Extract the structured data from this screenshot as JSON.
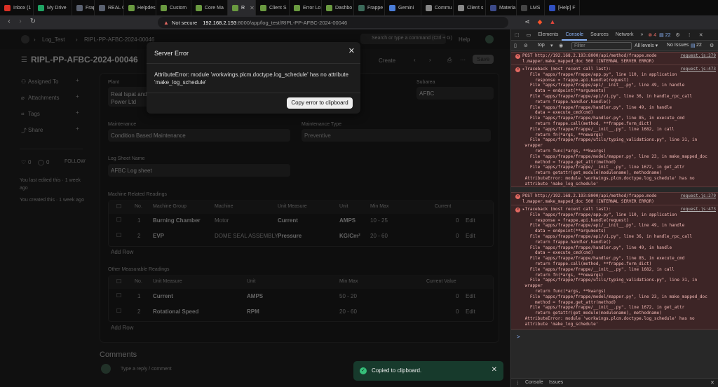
{
  "browser": {
    "tabs": [
      {
        "label": "Inbox (1",
        "color": "#d93025"
      },
      {
        "label": "My Drive",
        "color": "#1fa463"
      },
      {
        "label": "Frappe",
        "color": "#5a6170"
      },
      {
        "label": "REAL Gr",
        "color": "#5a6170"
      },
      {
        "label": "Helpdes",
        "color": "#6a9a40"
      },
      {
        "label": "Custom",
        "color": "#6a9a40"
      },
      {
        "label": "Core Ma",
        "color": "#6a9a40"
      },
      {
        "label": "R",
        "color": "#6a9a40"
      },
      {
        "label": "Client S",
        "color": "#6a9a40"
      },
      {
        "label": "Error Lo",
        "color": "#6a9a40"
      },
      {
        "label": "Dashbo",
        "color": "#6a9a40"
      },
      {
        "label": "Frappe",
        "color": "#3c6a5a"
      },
      {
        "label": "Gemini",
        "color": "#4a7dd9"
      },
      {
        "label": "Commu",
        "color": "#888888"
      },
      {
        "label": "Client s",
        "color": "#888888"
      },
      {
        "label": "Materia",
        "color": "#3c4a8a"
      },
      {
        "label": "LMS",
        "color": "#444444"
      },
      {
        "label": "[Help] F",
        "color": "#3050c0"
      }
    ],
    "security_label": "Not secure",
    "url_host": "192.168.2.193",
    "url_path": ":8000/app/log_test/RIPL-PP-AFBC-2024-00046"
  },
  "app": {
    "breadcrumb": "Log_Test",
    "breadcrumb_doc": "RIPL-PP-AFBC-2024-00046",
    "search_placeholder": "Search or type a command (Ctrl + G)",
    "help_label": "Help",
    "title": "RIPL-PP-AFBC-2024-00046",
    "create_label": "Create",
    "save_label": "Save",
    "sidebar": {
      "assigned_to": "Assigned To",
      "attachments": "Attachments",
      "tags": "Tags",
      "share": "Share",
      "likes": "0",
      "comments_count": "0",
      "follow": "FOLLOW",
      "last_edited": "You last edited this · 1 week ago",
      "created": "You created this · 1 week ago"
    },
    "fields": {
      "plant_label": "Plant",
      "plant_value": "Real Ispat and Power Ltd",
      "subarea_label": "Subarea",
      "subarea_value": "AFBC",
      "maintenance_label": "Maintenance",
      "maintenance_value": "Condition Based Maintenance",
      "maintenance_type_label": "Maintenance Type",
      "maintenance_type_value": "Preventive",
      "log_sheet_label": "Log Sheet Name",
      "log_sheet_value": "AFBC Log sheet"
    },
    "machine_readings": {
      "section_label": "Machine Related Readings",
      "headers": [
        "No.",
        "Machine Group",
        "Machine",
        "Unit Measure",
        "Unit",
        "Min Max",
        "Current"
      ],
      "rows": [
        {
          "no": "1",
          "group": "Burning Chamber",
          "machine": "Motor",
          "measure": "Current",
          "unit": "AMPS",
          "minmax": "10 - 25",
          "current": "0",
          "edit": "Edit"
        },
        {
          "no": "2",
          "group": "EVP",
          "machine": "DOME SEAL ASSEMBLY",
          "measure": "Pressure",
          "unit": "KG/Cm²",
          "minmax": "20 - 60",
          "current": "0",
          "edit": "Edit"
        }
      ],
      "add_row": "Add Row"
    },
    "other_readings": {
      "section_label": "Other Measurable Readings",
      "headers": [
        "No.",
        "Unit Measure",
        "Unit",
        "Min Max",
        "Current Value"
      ],
      "rows": [
        {
          "no": "1",
          "measure": "Current",
          "unit": "AMPS",
          "minmax": "50 - 20",
          "current": "0",
          "edit": "Edit"
        },
        {
          "no": "2",
          "measure": "Rotational Speed",
          "unit": "RPM",
          "minmax": "20 - 60",
          "current": "0",
          "edit": "Edit"
        }
      ],
      "add_row": "Add Row"
    },
    "comments_heading": "Comments",
    "comment_placeholder": "Type a reply / comment"
  },
  "modal": {
    "title": "Server Error",
    "message": "AttributeError: module 'workwings.plcm.doctype.log_schedule' has no attribute 'make_log_schedule'",
    "copy_button": "Copy error to clipboard"
  },
  "toast": {
    "message": "Copied to clipboard."
  },
  "devtools": {
    "tabs": [
      "Elements",
      "Console",
      "Sources",
      "Network"
    ],
    "error_count": "4",
    "message_count": "22",
    "context": "top",
    "filter_placeholder": "Filter",
    "levels": "All levels ▾",
    "issues_label": "No Issues",
    "issues_count": "22",
    "errors": [
      {
        "post_line_1": "POST http://192.168.2.193:8000/api/method/frappe.mode",
        "post_line_2": "l.mapper.make_mapped_doc 500 (INTERNAL SERVER ERROR)",
        "post_source": "request.js:279",
        "trace_source": "request.js:473",
        "trace": [
          "▸Traceback (most recent call last):",
          "   File \"apps/frappe/frappe/app.py\", line 110, in application",
          "     response = frappe.api.handle(request)",
          "   File \"apps/frappe/frappe/api/__init__.py\", line 49, in handle",
          "     data = endpoint(**arguments)",
          "   File \"apps/frappe/frappe/api/v1.py\", line 36, in handle_rpc_call",
          "     return frappe.handler.handle()",
          "   File \"apps/frappe/frappe/handler.py\", line 49, in handle",
          "     data = execute_cmd(cmd)",
          "   File \"apps/frappe/frappe/handler.py\", line 85, in execute_cmd",
          "     return frappe.call(method, **frappe.form_dict)",
          "   File \"apps/frappe/frappe/__init__.py\", line 1682, in call",
          "     return fn(*args, **newargs)",
          "   File \"apps/frappe/frappe/utils/typing_validations.py\", line 31, in",
          " wrapper",
          "     return func(*args, **kwargs)",
          "   File \"apps/frappe/frappe/model/mapper.py\", line 23, in make_mapped_doc",
          "     method = frappe.get_attr(method)",
          "   File \"apps/frappe/frappe/__init__.py\", line 1672, in get_attr",
          "     return getattr(get_module(modulename), methodname)",
          " AttributeError: module 'workwings.plcm.doctype.log_schedule' has no",
          " attribute 'make_log_schedule'"
        ]
      },
      {
        "post_line_1": "POST http://192.168.2.193:8000/api/method/frappe.mode",
        "post_line_2": "l.mapper.make_mapped_doc 500 (INTERNAL SERVER ERROR)",
        "post_source": "request.js:279",
        "trace_source": "request.js:473",
        "trace": [
          "▸Traceback (most recent call last):",
          "   File \"apps/frappe/frappe/app.py\", line 110, in application",
          "     response = frappe.api.handle(request)",
          "   File \"apps/frappe/frappe/api/__init__.py\", line 49, in handle",
          "     data = endpoint(**arguments)",
          "   File \"apps/frappe/frappe/api/v1.py\", line 36, in handle_rpc_call",
          "     return frappe.handler.handle()",
          "   File \"apps/frappe/frappe/handler.py\", line 49, in handle",
          "     data = execute_cmd(cmd)",
          "   File \"apps/frappe/frappe/handler.py\", line 85, in execute_cmd",
          "     return frappe.call(method, **frappe.form_dict)",
          "   File \"apps/frappe/frappe/__init__.py\", line 1682, in call",
          "     return fn(*args, **newargs)",
          "   File \"apps/frappe/frappe/utils/typing_validations.py\", line 31, in",
          " wrapper",
          "     return func(*args, **kwargs)",
          "   File \"apps/frappe/frappe/model/mapper.py\", line 23, in make_mapped_doc",
          "     method = frappe.get_attr(method)",
          "   File \"apps/frappe/frappe/__init__.py\", line 1672, in get_attr",
          "     return getattr(get_module(modulename), methodname)",
          " AttributeError: module 'workwings.plcm.doctype.log_schedule' has no",
          " attribute 'make_log_schedule'"
        ]
      }
    ],
    "prompt": ">",
    "bottom_tabs": [
      "Console",
      "Issues"
    ]
  }
}
